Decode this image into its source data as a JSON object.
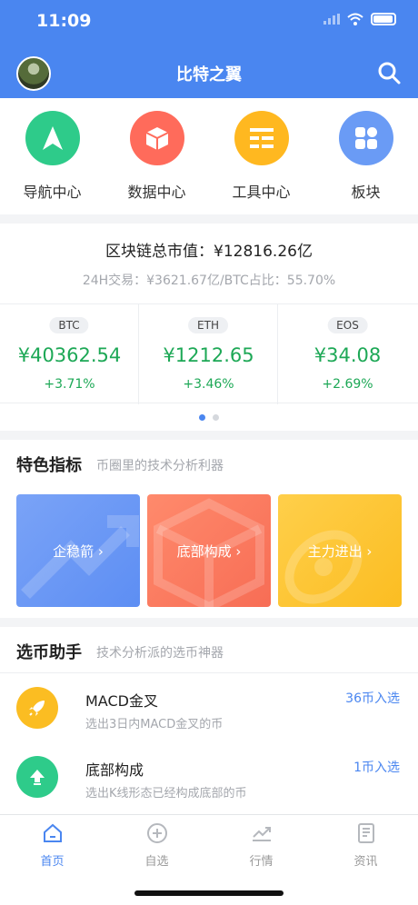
{
  "status_bar": {
    "time": "11:09"
  },
  "header": {
    "title": "比特之翼"
  },
  "nav": {
    "items": [
      {
        "label": "导航中心",
        "icon": "navigation-arrow-icon",
        "color": "#2ecb8a"
      },
      {
        "label": "数据中心",
        "icon": "data-cube-icon",
        "color": "#ff6b5b"
      },
      {
        "label": "工具中心",
        "icon": "tools-list-icon",
        "color": "#ffb820"
      },
      {
        "label": "板块",
        "icon": "grid-blocks-icon",
        "color": "#6a9bf5"
      }
    ]
  },
  "market": {
    "total": "区块链总市值：¥12816.26亿",
    "sub": "24H交易：¥3621.67亿/BTC占比：55.70%",
    "coins": [
      {
        "symbol": "BTC",
        "price": "¥40362.54",
        "change": "+3.71%"
      },
      {
        "symbol": "ETH",
        "price": "¥1212.65",
        "change": "+3.46%"
      },
      {
        "symbol": "EOS",
        "price": "¥34.08",
        "change": "+2.69%"
      }
    ]
  },
  "features": {
    "title": "特色指标",
    "subtitle": "币圈里的技术分析利器",
    "cards": [
      {
        "label": "企稳箭 ›",
        "color_start": "#7aa3f7",
        "color_end": "#5d8ef3"
      },
      {
        "label": "底部构成 ›",
        "color_start": "#ff8a6c",
        "color_end": "#f76d55"
      },
      {
        "label": "主力进出 ›",
        "color_start": "#ffcf4a",
        "color_end": "#fbbd22"
      }
    ]
  },
  "picker": {
    "title": "选币助手",
    "subtitle": "技术分析派的选币神器",
    "items": [
      {
        "name": "MACD金叉",
        "desc": "选出3日内MACD金叉的币",
        "count": "36币入选",
        "icon": "rocket-icon",
        "color": "#fbbd22"
      },
      {
        "name": "底部构成",
        "desc": "选出K线形态已经构成底部的币",
        "count": "1币入选",
        "icon": "arrow-up-icon",
        "color": "#2ecb8a"
      }
    ]
  },
  "tabs": [
    {
      "label": "首页",
      "icon": "home-icon",
      "active": true
    },
    {
      "label": "自选",
      "icon": "add-circle-icon",
      "active": false
    },
    {
      "label": "行情",
      "icon": "chart-icon",
      "active": false
    },
    {
      "label": "资讯",
      "icon": "news-icon",
      "active": false
    }
  ]
}
